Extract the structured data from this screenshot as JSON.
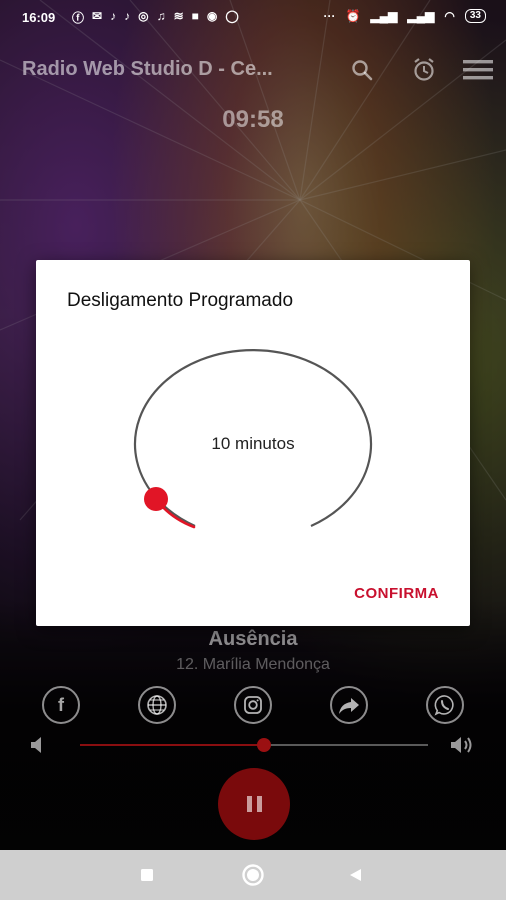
{
  "status_bar": {
    "time": "16:09",
    "battery": "33",
    "left_icons": [
      "facebook-icon",
      "sms-icon",
      "tiktok-icon",
      "tiktok-icon",
      "cast-icon",
      "music-icon",
      "wifi-calling-icon",
      "message-icon",
      "chat-icon",
      "whatsapp-icon"
    ],
    "more": "···"
  },
  "app_bar": {
    "title": "Radio Web Studio D - Ce..."
  },
  "clock": "09:58",
  "player": {
    "track_title": "Ausência",
    "track_artist": "12. Marília Mendonça",
    "volume_percent": 53,
    "state": "playing"
  },
  "social": [
    {
      "name": "facebook",
      "glyph": "f"
    },
    {
      "name": "website",
      "glyph": ""
    },
    {
      "name": "instagram",
      "glyph": ""
    },
    {
      "name": "share",
      "glyph": ""
    },
    {
      "name": "whatsapp",
      "glyph": ""
    }
  ],
  "dialog": {
    "title": "Desligamento Programado",
    "value_label": "10 minutos",
    "confirm_label": "CONFIRMA",
    "accent_color": "#e11526"
  },
  "colors": {
    "accent": "#c8102e",
    "player_red": "#7a0a0c"
  }
}
